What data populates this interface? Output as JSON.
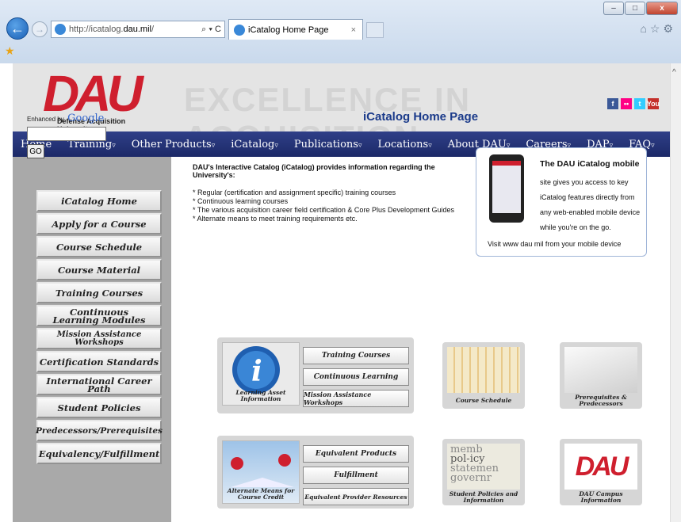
{
  "browser": {
    "url_prefix": "http://icatalog.",
    "url_domain": "dau.mil",
    "url_suffix": "/",
    "tools": "⌕ ▾ C",
    "tab_title": "iCatalog Home Page",
    "tab_close": "×",
    "win_min": "–",
    "win_max": "□",
    "win_close": "x",
    "right_icons": "⌂☆⚙"
  },
  "header": {
    "logo_letters": "DAU",
    "logo_sub": "Defense Acquisition University",
    "watermark": "EXCELLENCE IN ACQUISITION",
    "social": [
      "f",
      "••",
      "t",
      "You"
    ]
  },
  "menu": [
    {
      "label": "Home",
      "caret": ""
    },
    {
      "label": "Training",
      "caret": "▿"
    },
    {
      "label": "Other Products",
      "caret": "▿"
    },
    {
      "label": "iCatalog",
      "caret": "▿"
    },
    {
      "label": "Publications",
      "caret": "▿"
    },
    {
      "label": "Locations",
      "caret": "▿"
    },
    {
      "label": "About DAU",
      "caret": "▿"
    },
    {
      "label": "Careers",
      "caret": "▿"
    },
    {
      "label": "DAP",
      "caret": "▿"
    },
    {
      "label": "FAQ",
      "caret": "▿"
    }
  ],
  "search": {
    "enhanced_by": "Enhanced by",
    "google": "Google",
    "go": "GO",
    "value": ""
  },
  "sidebar": [
    "iCatalog Home",
    "Apply for a Course",
    "Course Schedule",
    "Course Material",
    "Training Courses",
    "Continuous Learning Modules",
    "Mission Assistance Workshops",
    "Certification Standards",
    "International Career Path",
    "Student Policies",
    "Predecessors/Prerequisites",
    "Equivalency/Fulfillment"
  ],
  "main": {
    "title": "iCatalog Home Page",
    "lead": "DAU's Interactive Catalog (iCatalog) provides information regarding the University's:",
    "bullets": [
      "* Regular (certification and assignment specific) training courses",
      "* Continuous learning courses",
      "* The various acquisition career field certification & Core Plus Development Guides",
      "* Alternate means to meet training requirements etc."
    ]
  },
  "mobile": {
    "title": "The DAU iCatalog mobile",
    "text": "site gives you access to key iCatalog features directly from any web-enabled mobile device while you're on the go.",
    "footer": "Visit www dau mil from your mobile device"
  },
  "panel1": {
    "caption": "Learning Asset Information",
    "buttons": [
      "Training Courses",
      "Continuous Learning",
      "Mission Assistance Workshops"
    ]
  },
  "panel2": {
    "caption": "Alternate Means for Course Credit",
    "buttons": [
      "Equivalent Products",
      "Fulfillment",
      "Equivalent Provider Resources"
    ]
  },
  "tiles": {
    "schedule": "Course Schedule",
    "prereq": "Prerequisites & Predecessors",
    "policies": "Student Policies and Information",
    "campus": "DAU Campus Information",
    "policy_words": [
      "memb",
      "pol-icy",
      "statemen",
      "governr"
    ]
  },
  "colors": {
    "brand_red": "#cf1f2e",
    "menu_blue": "#1c2968",
    "title_blue": "#1a3a8a"
  }
}
